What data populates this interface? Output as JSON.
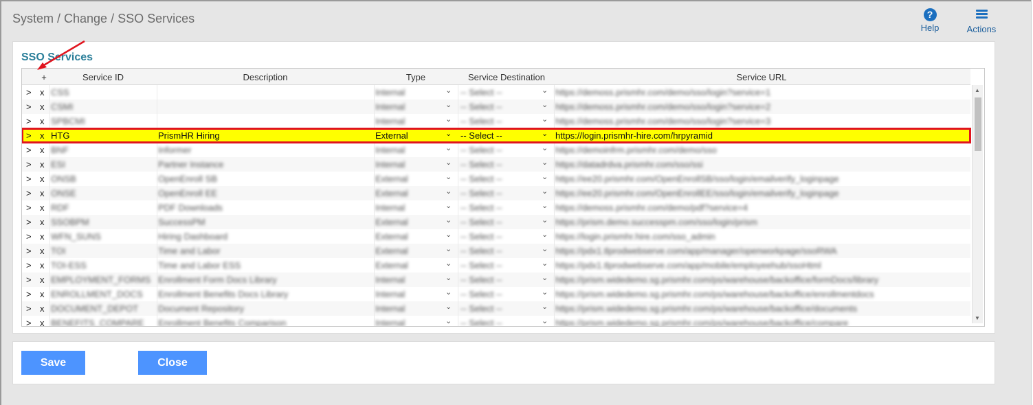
{
  "header": {
    "breadcrumb": "System / Change / SSO Services",
    "help_label": "Help",
    "actions_label": "Actions"
  },
  "panel": {
    "title": "SSO Services",
    "columns": {
      "add": "+",
      "service_id": "Service ID",
      "description": "Description",
      "type": "Type",
      "service_destination": "Service Destination",
      "service_url": "Service URL"
    },
    "row_controls": {
      "expand": ">",
      "delete": "x"
    },
    "rows": [
      {
        "id": "CSS",
        "description": "",
        "type": "Internal",
        "destination": "-- Select --",
        "url": "https://demoss.prismhr.com/demo/sso/login?service=1"
      },
      {
        "id": "CSMI",
        "description": "",
        "type": "Internal",
        "destination": "-- Select --",
        "url": "https://demoss.prismhr.com/demo/sso/login?service=2"
      },
      {
        "id": "SPBCMI",
        "description": "",
        "type": "Internal",
        "destination": "-- Select --",
        "url": "https://demoss.prismhr.com/demo/sso/login?service=3"
      },
      {
        "id": "HTG",
        "description": "PrismHR Hiring",
        "type": "External",
        "destination": "-- Select --",
        "url": "https://login.prismhr-hire.com/hrpyramid",
        "selected": true
      },
      {
        "id": "BNF",
        "description": "Informer",
        "type": "Internal",
        "destination": "-- Select --",
        "url": "https://demoinfrm.prismhr.com/demo/sso"
      },
      {
        "id": "ESI",
        "description": "Partner Instance",
        "type": "Internal",
        "destination": "-- Select --",
        "url": "https://datadrdva.prismhr.com/sso/ssi"
      },
      {
        "id": "ONSB",
        "description": "OpenEnroll SB",
        "type": "External",
        "destination": "-- Select --",
        "url": "https://ee20.prismhr.com/OpenEnrollSB/sso/login/emailverify_loginpage"
      },
      {
        "id": "ONSE",
        "description": "OpenEnroll EE",
        "type": "External",
        "destination": "-- Select --",
        "url": "https://ee20.prismhr.com/OpenEnrollEE/sso/login/emailverify_loginpage"
      },
      {
        "id": "RDF",
        "description": "PDF Downloads",
        "type": "Internal",
        "destination": "-- Select --",
        "url": "https://demoss.prismhr.com/demo/pdf?service=4"
      },
      {
        "id": "SSOBPM",
        "description": "SuccessPM",
        "type": "External",
        "destination": "-- Select --",
        "url": "https://prism.demo.successpm.com/sso/login/prism"
      },
      {
        "id": "WFN_SUNS",
        "description": "Hiring Dashboard",
        "type": "External",
        "destination": "-- Select --",
        "url": "https://login.prismhr.hire.com/sso_admin"
      },
      {
        "id": "TOI",
        "description": "Time and Labor",
        "type": "External",
        "destination": "-- Select --",
        "url": "https://pdx1.tlprodwebserve.com/app/manager/openworkpage/ssoRWA"
      },
      {
        "id": "TOI-ESS",
        "description": "Time and Labor ESS",
        "type": "External",
        "destination": "-- Select --",
        "url": "https://pdx1.tlprodwebserve.com/app/mobile/employeehub/ssoHtml"
      },
      {
        "id": "EMPLOYMENT_FORMS",
        "description": "Enrollment Form Docs Library",
        "type": "Internal",
        "destination": "-- Select --",
        "url": "https://prism.widedemo.sg.prismhr.com/ps/warehouse/backoffice/formDocs/library"
      },
      {
        "id": "ENROLLMENT_DOCS",
        "description": "Enrollment Benefits Docs Library",
        "type": "Internal",
        "destination": "-- Select --",
        "url": "https://prism.widedemo.sg.prismhr.com/ps/warehouse/backoffice/enrollmentdocs"
      },
      {
        "id": "DOCUMENT_DEPOT",
        "description": "Document Repository",
        "type": "Internal",
        "destination": "-- Select --",
        "url": "https://prism.widedemo.sg.prismhr.com/ps/warehouse/backoffice/documents"
      },
      {
        "id": "BENEFITS_COMPARE",
        "description": "Enrollment Benefits Comparison",
        "type": "Internal",
        "destination": "-- Select --",
        "url": "https://prism.widedemo.sg.prismhr.com/ps/warehouse/backoffice/compare"
      }
    ]
  },
  "footer": {
    "save_label": "Save",
    "close_label": "Close"
  },
  "colors": {
    "accent": "#4d94ff",
    "panel_title": "#2b7f9a",
    "highlight_row": "#ffff00",
    "highlight_border": "#e0141e"
  },
  "icons": {
    "help": "question-circle-icon",
    "actions": "hamburger-menu-icon",
    "annotation": "red-arrow-icon"
  }
}
